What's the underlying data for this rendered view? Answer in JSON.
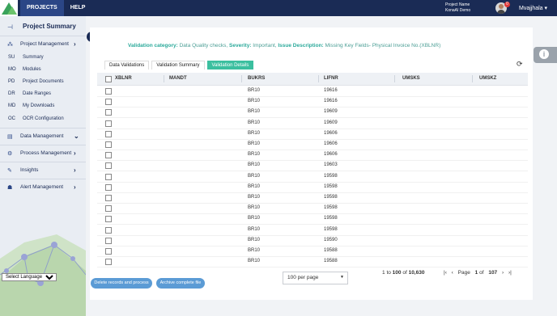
{
  "topnav": {
    "projects": "PROJECTS",
    "help": "HELP"
  },
  "project": {
    "name_label": "Project Name",
    "name": "KonaAI Demo"
  },
  "user": {
    "notifications": "0",
    "name": "Mvajjhala"
  },
  "sidebar": {
    "title": "Project Summary",
    "sections": {
      "project_management": "Project Management",
      "data_management": "Data Management",
      "process_management": "Process Management",
      "insights": "Insights",
      "alert_management": "Alert Management"
    },
    "items": [
      {
        "abbr": "SU",
        "label": "Summary"
      },
      {
        "abbr": "MO",
        "label": "Modules"
      },
      {
        "abbr": "PD",
        "label": "Project Documents"
      },
      {
        "abbr": "DR",
        "label": "Date Ranges"
      },
      {
        "abbr": "MD",
        "label": "My Downloads"
      },
      {
        "abbr": "OC",
        "label": "OCR Configuration"
      }
    ],
    "language": "Select Language"
  },
  "validation": {
    "category_label": "Validation category:",
    "category": "Data Quality checks,",
    "severity_label": "Severity:",
    "severity": "Important,",
    "description_label": "Issue Description:",
    "description": "Missing Key Fields- Physical Invoice No.(XBLNR)"
  },
  "tabs": [
    "Data Validations",
    "Validation Summary",
    "Validation Details"
  ],
  "columns": [
    "XBLNR",
    "MANDT",
    "BUKRS",
    "LIFNR",
    "UMSKS",
    "UMSKZ"
  ],
  "rows": [
    {
      "bukrs": "BR10",
      "lifnr": "19616"
    },
    {
      "bukrs": "BR10",
      "lifnr": "19616"
    },
    {
      "bukrs": "BR10",
      "lifnr": "19609"
    },
    {
      "bukrs": "BR10",
      "lifnr": "19609"
    },
    {
      "bukrs": "BR10",
      "lifnr": "19606"
    },
    {
      "bukrs": "BR10",
      "lifnr": "19606"
    },
    {
      "bukrs": "BR10",
      "lifnr": "19606"
    },
    {
      "bukrs": "BR10",
      "lifnr": "19603"
    },
    {
      "bukrs": "BR10",
      "lifnr": "19598"
    },
    {
      "bukrs": "BR10",
      "lifnr": "19598"
    },
    {
      "bukrs": "BR10",
      "lifnr": "19598"
    },
    {
      "bukrs": "BR10",
      "lifnr": "19598"
    },
    {
      "bukrs": "BR10",
      "lifnr": "19598"
    },
    {
      "bukrs": "BR10",
      "lifnr": "19598"
    },
    {
      "bukrs": "BR10",
      "lifnr": "19590"
    },
    {
      "bukrs": "BR10",
      "lifnr": "19588"
    },
    {
      "bukrs": "BR10",
      "lifnr": "19588"
    }
  ],
  "footer": {
    "delete_button": "Delete records and process",
    "archive_button": "Archive complete file",
    "per_page": "100 per page",
    "range_from": "1",
    "range_to_word": "to",
    "range_to": "100",
    "range_of_word": "of",
    "range_total": "10,630",
    "page_word": "Page",
    "page_current": "1",
    "page_of_word": "of",
    "page_total": "107"
  },
  "colors": {
    "topbar": "#1a2b55",
    "accent": "#3bbf9f",
    "button": "#5b9bd5",
    "info_text": "#2aa99a"
  },
  "icons": [
    "pin-icon",
    "sitemap-icon",
    "database-icon",
    "gears-icon",
    "edit-icon",
    "people-icon",
    "refresh-icon",
    "info-icon",
    "chevron-right-icon",
    "chevron-down-icon",
    "arrow-left-icon"
  ]
}
